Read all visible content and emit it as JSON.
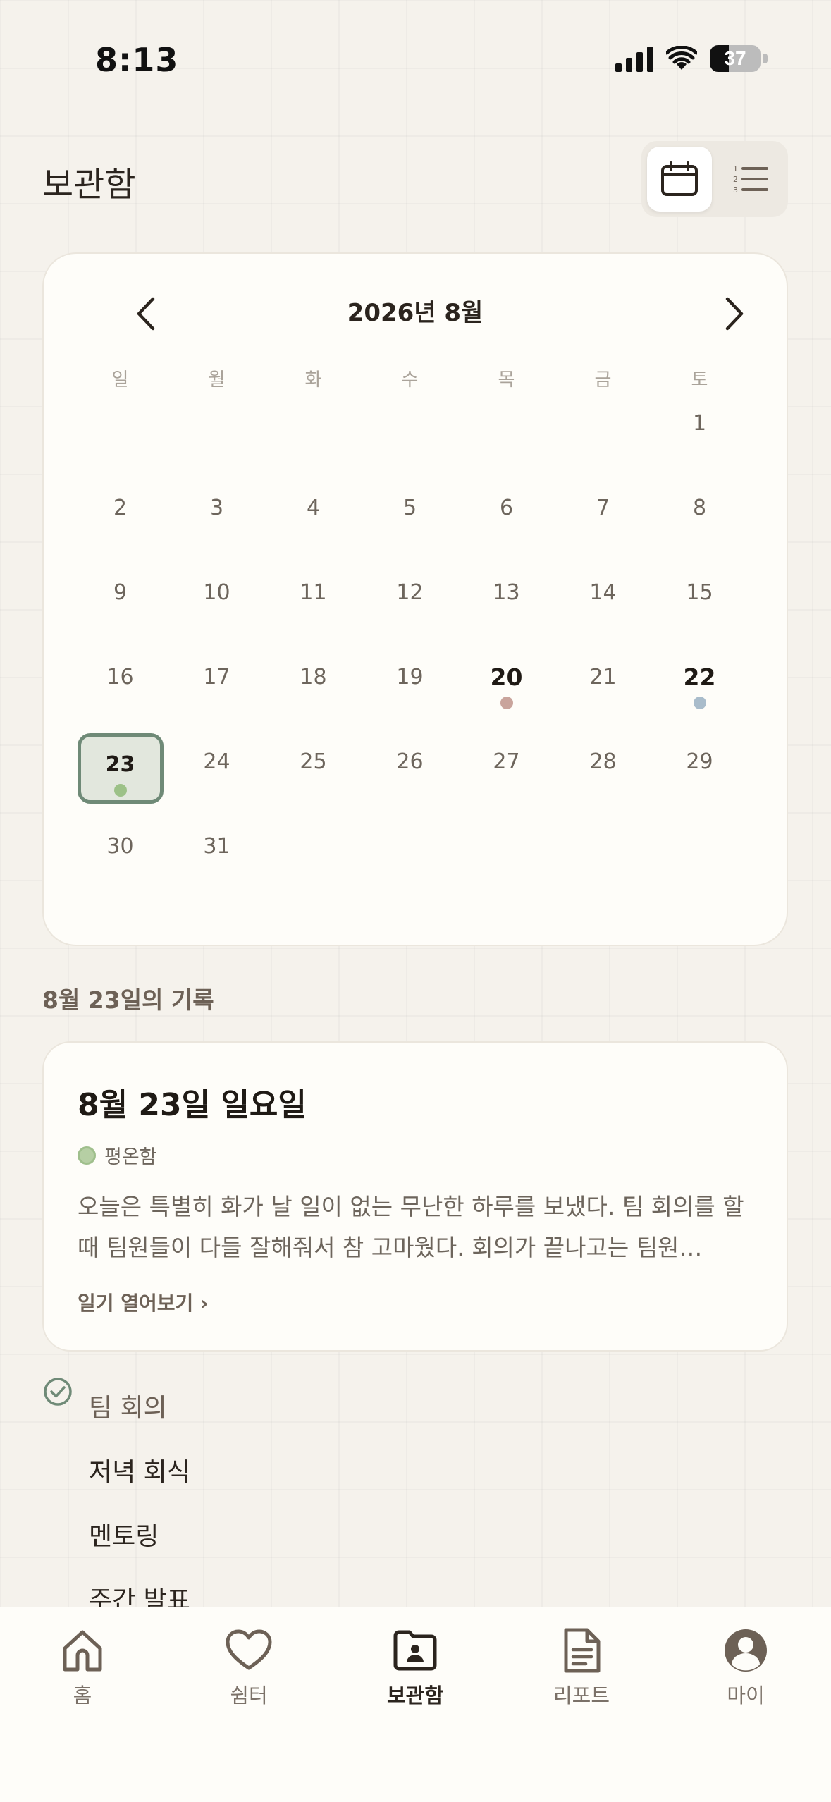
{
  "status_bar": {
    "time": "8:13",
    "battery": "37"
  },
  "header": {
    "title": "보관함"
  },
  "calendar": {
    "month_title": "2026년 8월",
    "weekdays": [
      "일",
      "월",
      "화",
      "수",
      "목",
      "금",
      "토"
    ],
    "days": [
      {
        "n": ""
      },
      {
        "n": ""
      },
      {
        "n": ""
      },
      {
        "n": ""
      },
      {
        "n": ""
      },
      {
        "n": ""
      },
      {
        "n": "1"
      },
      {
        "n": "2"
      },
      {
        "n": "3"
      },
      {
        "n": "4"
      },
      {
        "n": "5"
      },
      {
        "n": "6"
      },
      {
        "n": "7"
      },
      {
        "n": "8"
      },
      {
        "n": "9"
      },
      {
        "n": "10"
      },
      {
        "n": "11"
      },
      {
        "n": "12"
      },
      {
        "n": "13"
      },
      {
        "n": "14"
      },
      {
        "n": "15"
      },
      {
        "n": "16"
      },
      {
        "n": "17"
      },
      {
        "n": "18"
      },
      {
        "n": "19"
      },
      {
        "n": "20",
        "dot": "#c9a49c",
        "bold": true
      },
      {
        "n": "21"
      },
      {
        "n": "22",
        "dot": "#a9bccb",
        "bold": true
      },
      {
        "n": "23",
        "dot": "#9cc187",
        "selected": true
      },
      {
        "n": "24"
      },
      {
        "n": "25"
      },
      {
        "n": "26"
      },
      {
        "n": "27"
      },
      {
        "n": "28"
      },
      {
        "n": "29"
      },
      {
        "n": "30"
      },
      {
        "n": "31"
      }
    ]
  },
  "records": {
    "section_title": "8월 23일의 기록",
    "entry": {
      "date": "8월 23일 일요일",
      "mood": "평온함",
      "text": "오늘은 특별히 화가 날 일이 없는 무난한 하루를 보냈다. 팀 회의를 할 때 팀원들이 다들 잘해줘서 참 고마웠다. 회의가 끝나고는 팀원…",
      "open_link": "일기 열어보기 ›"
    },
    "events": [
      {
        "label": "팀 회의",
        "done": true
      },
      {
        "label": "저녁 회식",
        "done": false
      },
      {
        "label": "멘토링",
        "done": false
      },
      {
        "label": "주간 발표",
        "done": false
      }
    ]
  },
  "nav": {
    "home": "홈",
    "shelter": "쉼터",
    "archive": "보관함",
    "report": "리포트",
    "my": "마이"
  },
  "colors": {
    "accent": "#6f8a77",
    "background": "#f5f2ec",
    "card": "#fefdf9"
  }
}
